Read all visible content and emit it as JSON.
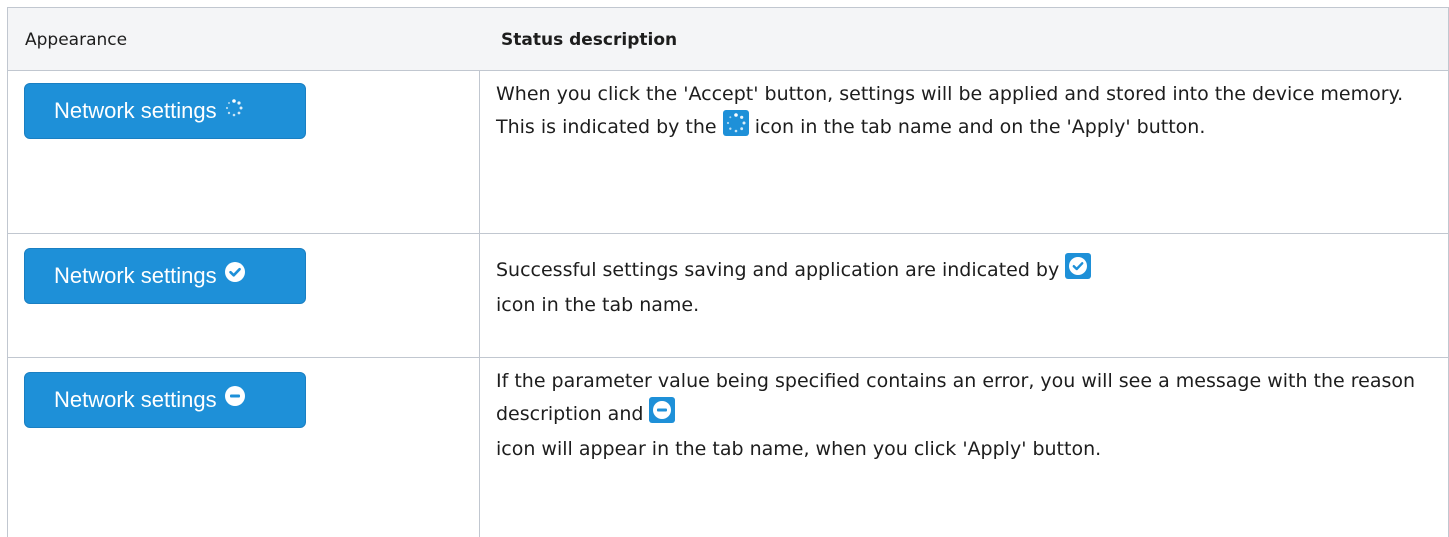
{
  "table": {
    "header": {
      "appearance": "Appearance",
      "status_description": "Status description"
    },
    "rows": [
      {
        "button_label": "Network settings",
        "button_icon": "spinner-icon",
        "description_part1": "When you click the 'Accept' button, settings will be applied and stored into the device memory. This is indicated by the",
        "inline_icon": "spinner-icon",
        "description_part2": "icon in the  tab name and on the 'Apply' button."
      },
      {
        "button_label": "Network settings",
        "button_icon": "check-circle-icon",
        "description_part1": "Successful settings saving and application are indicated by",
        "inline_icon": "check-circle-icon",
        "description_part2": "icon in the tab name."
      },
      {
        "button_label": "Network settings",
        "button_icon": "minus-circle-icon",
        "description_part1": "If the parameter value being specified contains an error, you will see a message with the reason description and",
        "inline_icon": "minus-circle-icon",
        "description_part2": "icon will appear in the tab name, when you click 'Apply' button."
      }
    ]
  },
  "colors": {
    "button_background": "#1e90d8",
    "header_background": "#f4f5f7",
    "border": "#c1c7d0",
    "text": "#1d1d1d"
  }
}
